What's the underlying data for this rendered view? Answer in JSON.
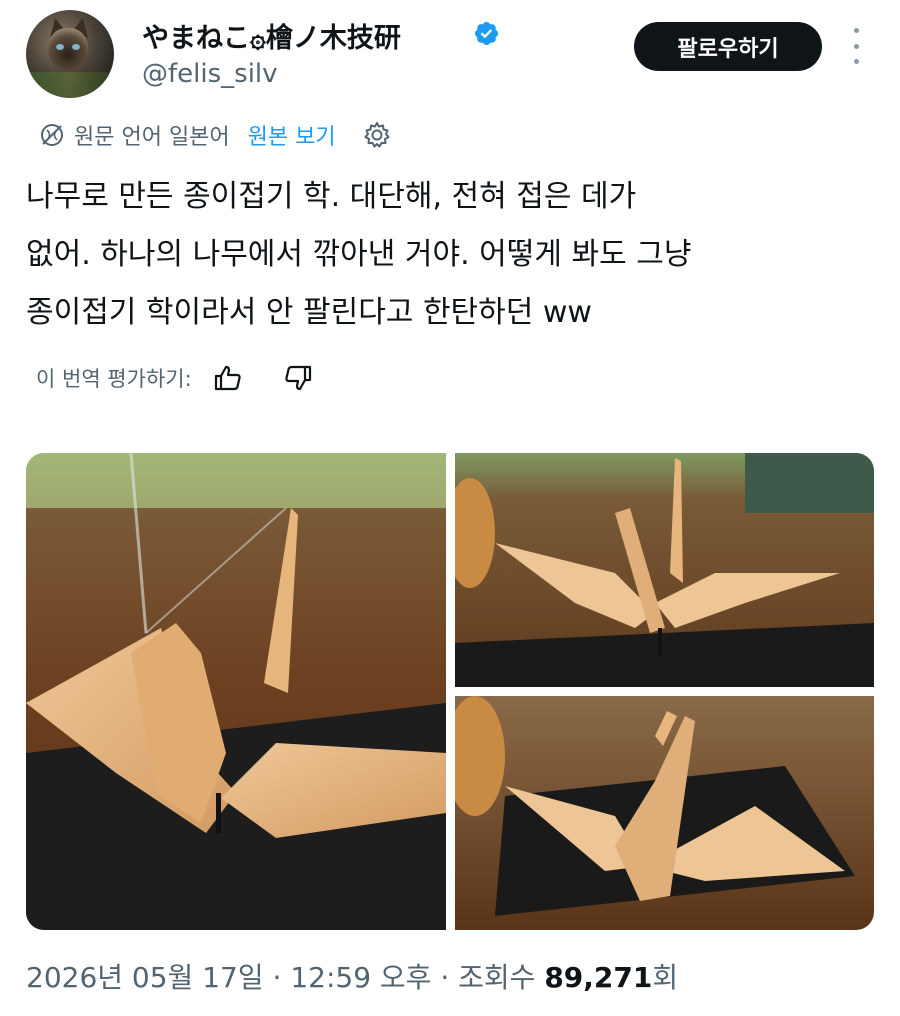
{
  "author": {
    "display_name": "やまねこ۞檜ノ木技研",
    "handle": "@felis_silv",
    "verified": true,
    "avatar": "cat-avatar"
  },
  "follow_button": {
    "label": "팔로우하기"
  },
  "more_menu": {
    "icon": "more-vertical-icon"
  },
  "translation": {
    "original_language_label": "원문 언어 일본어",
    "show_original_label": "원본 보기",
    "globe_icon": "translate-globe-icon",
    "settings_icon": "gear-icon"
  },
  "tweet": {
    "lines": [
      "나무로 만든 종이접기 학. 대단해, 전혀 접은 데가",
      "없어. 하나의 나무에서 깎아낸 거야. 어떻게 봐도 그냥",
      "종이접기 학이라서 안 팔린다고 한탄하던 ww"
    ]
  },
  "rating": {
    "label": "이 번역 평가하기:",
    "thumbs_up_icon": "thumbs-up-icon",
    "thumbs_down_icon": "thumbs-down-icon"
  },
  "media": [
    {
      "name": "photo-wooden-crane-closeup"
    },
    {
      "name": "photo-wooden-crane-side"
    },
    {
      "name": "photo-wooden-crane-angle"
    }
  ],
  "meta": {
    "date": "2026년 05월 17일",
    "separator": " · ",
    "time": "12:59 오후",
    "views_label": "조회수",
    "views_count": "89,271",
    "views_suffix": "회"
  },
  "colors": {
    "text_primary": "#0f1419",
    "text_secondary": "#536471",
    "link": "#1d9bf0",
    "button_bg": "#0f1419"
  }
}
